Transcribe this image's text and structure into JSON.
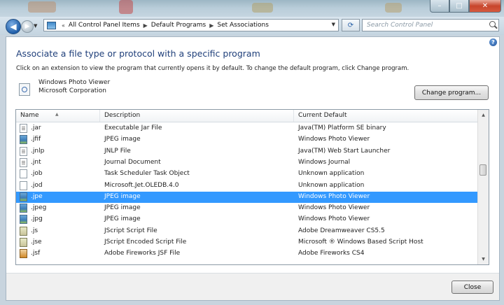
{
  "address_bar": {
    "segments": [
      "All Control Panel Items",
      "Default Programs",
      "Set Associations"
    ],
    "search_placeholder": "Search Control Panel"
  },
  "heading": "Associate a file type or protocol with a specific program",
  "description": "Click on an extension to view the program that currently opens it by default. To change the default program, click Change program.",
  "current_program": {
    "name": "Windows Photo Viewer",
    "company": "Microsoft Corporation"
  },
  "change_program_label": "Change program...",
  "columns": {
    "name": "Name",
    "description": "Description",
    "current_default": "Current Default"
  },
  "rows": [
    {
      "name": ".jar",
      "description": "Executable Jar File",
      "default": "Java(TM) Platform SE binary",
      "icon": "jar-file-icon"
    },
    {
      "name": ".jfif",
      "description": "JPEG image",
      "default": "Windows Photo Viewer",
      "icon": "image-file-icon"
    },
    {
      "name": ".jnlp",
      "description": "JNLP File",
      "default": "Java(TM) Web Start Launcher",
      "icon": "jnlp-file-icon"
    },
    {
      "name": ".jnt",
      "description": "Journal Document",
      "default": "Windows Journal",
      "icon": "journal-file-icon"
    },
    {
      "name": ".job",
      "description": "Task Scheduler Task Object",
      "default": "Unknown application",
      "icon": "generic-file-icon"
    },
    {
      "name": ".jod",
      "description": "Microsoft.Jet.OLEDB.4.0",
      "default": "Unknown application",
      "icon": "generic-file-icon"
    },
    {
      "name": ".jpe",
      "description": "JPEG image",
      "default": "Windows Photo Viewer",
      "icon": "image-file-icon",
      "selected": true
    },
    {
      "name": ".jpeg",
      "description": "JPEG image",
      "default": "Windows Photo Viewer",
      "icon": "image-file-icon"
    },
    {
      "name": ".jpg",
      "description": "JPEG image",
      "default": "Windows Photo Viewer",
      "icon": "image-file-icon"
    },
    {
      "name": ".js",
      "description": "JScript Script File",
      "default": "Adobe Dreamweaver CS5.5",
      "icon": "script-file-icon"
    },
    {
      "name": ".jse",
      "description": "JScript Encoded Script File",
      "default": "Microsoft ® Windows Based Script Host",
      "icon": "script-file-icon"
    },
    {
      "name": ".jsf",
      "description": "Adobe Fireworks JSF File",
      "default": "Adobe Fireworks CS4",
      "icon": "fireworks-file-icon"
    }
  ],
  "close_label": "Close",
  "colors": {
    "selection": "#3399ff",
    "heading": "#1f3f7a"
  }
}
